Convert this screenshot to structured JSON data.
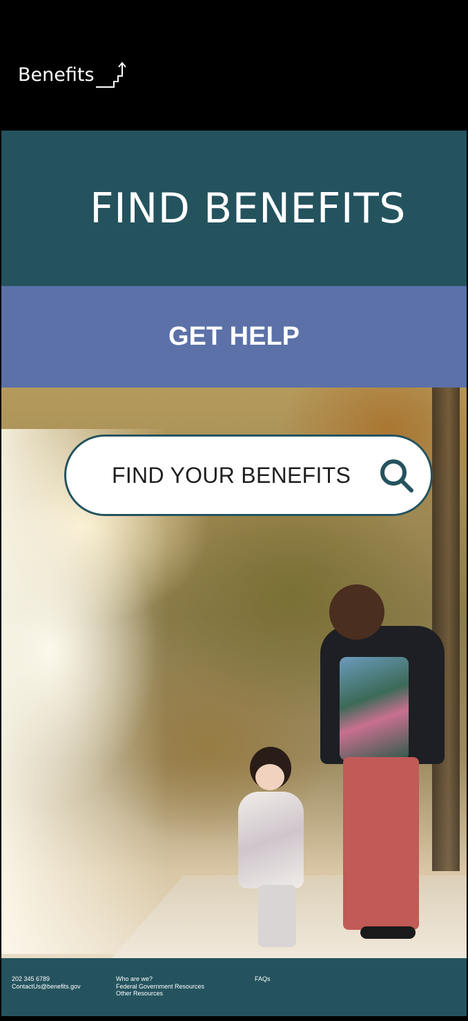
{
  "header": {
    "logo_text": "Benefits"
  },
  "hero": {
    "title": "FIND BENEFITS"
  },
  "help": {
    "label": "GET HELP"
  },
  "search": {
    "label": "FIND YOUR BENEFITS"
  },
  "footer": {
    "phone": "202 345 6789",
    "email": "ContactUs@benefits.gov",
    "links": [
      "Who are we?",
      "Federal Government Resources",
      "Other Resources"
    ],
    "faqs": "FAQs"
  },
  "colors": {
    "hero_bg": "#24535e",
    "help_bg": "#5b71a8",
    "footer_bg": "#24535e"
  }
}
